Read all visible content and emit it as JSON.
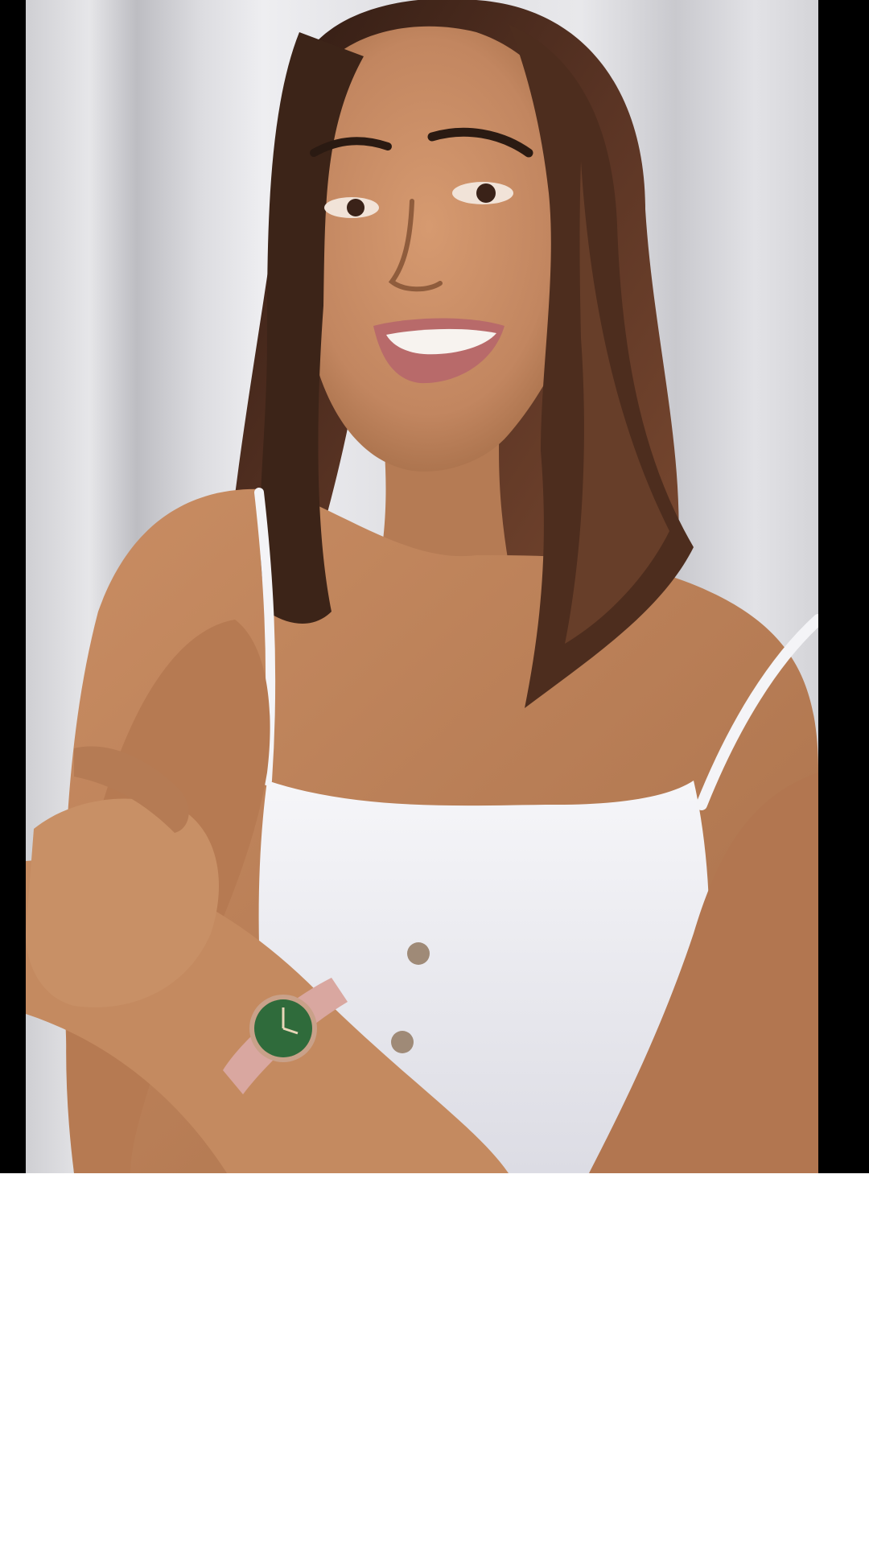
{
  "photo": {
    "subject": "smiling-woman-portrait",
    "colors": {
      "curtain": "#d9d9dc",
      "curtain_shadow": "#b8b8bd",
      "skin": "#c58a61",
      "skin_shadow": "#9f6a45",
      "hair": "#4a2c1f",
      "hair_highlight": "#7a4a30",
      "top": "#f3f3f6",
      "top_shadow": "#d6d6de",
      "lips": "#b86a6a",
      "watch_dial": "#2f6b3b",
      "watch_strap": "#d9a7a0",
      "letterbox": "#000000",
      "page_background": "#ffffff"
    }
  }
}
